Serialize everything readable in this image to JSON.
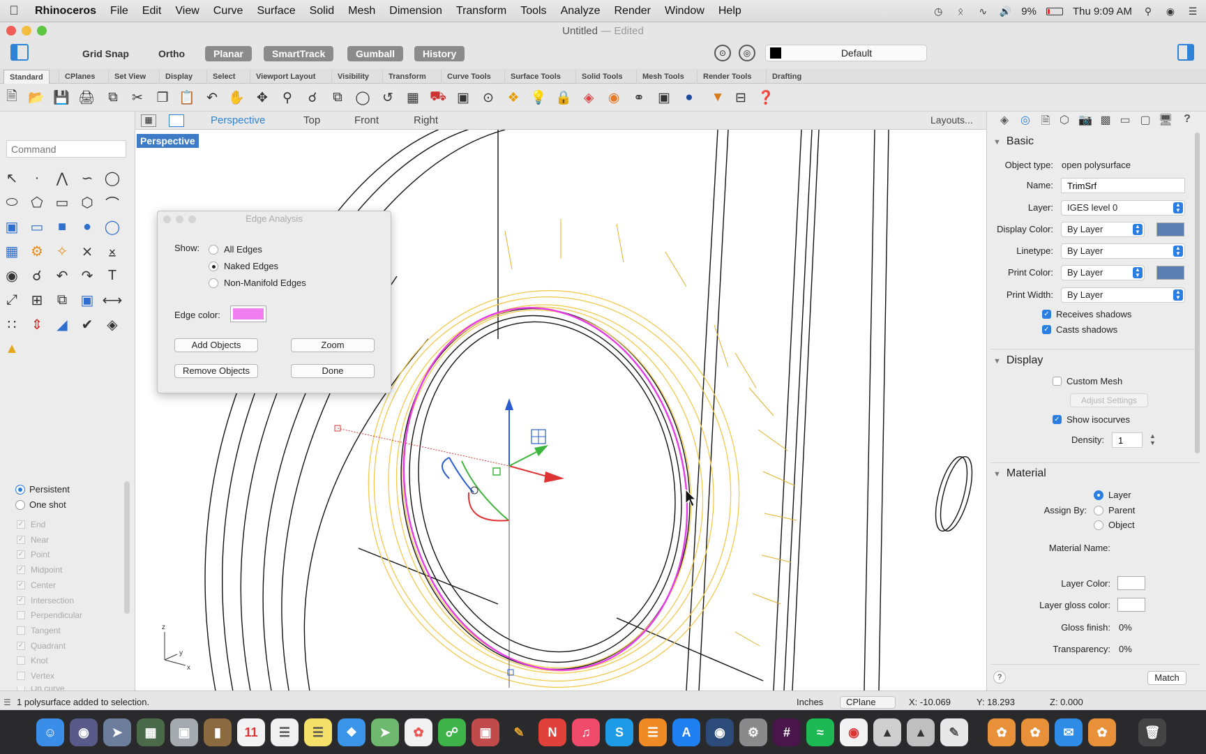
{
  "menubar": {
    "app_name": "Rhinoceros",
    "items": [
      "File",
      "Edit",
      "View",
      "Curve",
      "Surface",
      "Solid",
      "Mesh",
      "Dimension",
      "Transform",
      "Tools",
      "Analyze",
      "Render",
      "Window",
      "Help"
    ],
    "battery": "9%",
    "clock": "Thu 9:09 AM"
  },
  "window": {
    "title": "Untitled",
    "title_suffix": "— Edited"
  },
  "toggles": {
    "grid_snap": "Grid Snap",
    "ortho": "Ortho",
    "planar": "Planar",
    "smarttrack": "SmartTrack",
    "gumball": "Gumball",
    "history": "History",
    "layer": "Default"
  },
  "tabs": [
    "Standard",
    "CPlanes",
    "Set View",
    "Display",
    "Select",
    "Viewport Layout",
    "Visibility",
    "Transform",
    "Curve Tools",
    "Surface Tools",
    "Solid Tools",
    "Mesh Tools",
    "Render Tools",
    "Drafting"
  ],
  "command": {
    "placeholder": "Command"
  },
  "viewport_tabs": {
    "perspective": "Perspective",
    "top": "Top",
    "front": "Front",
    "right": "Right",
    "layouts": "Layouts..."
  },
  "viewport": {
    "label": "Perspective"
  },
  "osnap": {
    "persistent": "Persistent",
    "one_shot": "One shot",
    "items": [
      {
        "label": "End",
        "checked": true
      },
      {
        "label": "Near",
        "checked": true
      },
      {
        "label": "Point",
        "checked": true
      },
      {
        "label": "Midpoint",
        "checked": true
      },
      {
        "label": "Center",
        "checked": true
      },
      {
        "label": "Intersection",
        "checked": true
      },
      {
        "label": "Perpendicular",
        "checked": false
      },
      {
        "label": "Tangent",
        "checked": false
      },
      {
        "label": "Quadrant",
        "checked": true
      },
      {
        "label": "Knot",
        "checked": false
      },
      {
        "label": "Vertex",
        "checked": false
      },
      {
        "label": "On curve",
        "checked": false
      }
    ]
  },
  "dialog": {
    "title": "Edge Analysis",
    "show_label": "Show:",
    "all_edges": "All Edges",
    "naked_edges": "Naked Edges",
    "non_manifold": "Non-Manifold Edges",
    "edge_color_label": "Edge color:",
    "edge_color": "#f07ef0",
    "add_objects": "Add Objects",
    "zoom": "Zoom",
    "remove_objects": "Remove Objects",
    "done": "Done"
  },
  "properties": {
    "basic_header": "Basic",
    "object_type_label": "Object type:",
    "object_type": "open polysurface",
    "name_label": "Name:",
    "name": "TrimSrf",
    "layer_label": "Layer:",
    "layer": "IGES level 0",
    "display_color_label": "Display Color:",
    "display_color": "By Layer",
    "linetype_label": "Linetype:",
    "linetype": "By Layer",
    "print_color_label": "Print Color:",
    "print_color": "By Layer",
    "print_width_label": "Print Width:",
    "print_width": "By Layer",
    "receives_shadows": "Receives shadows",
    "casts_shadows": "Casts shadows",
    "display_header": "Display",
    "custom_mesh": "Custom Mesh",
    "adjust_settings": "Adjust Settings",
    "show_isocurves": "Show isocurves",
    "density_label": "Density:",
    "density": "1",
    "material_header": "Material",
    "assign_by_label": "Assign By:",
    "assign_layer": "Layer",
    "assign_parent": "Parent",
    "assign_object": "Object",
    "material_name_label": "Material Name:",
    "layer_color_label": "Layer Color:",
    "layer_gloss_label": "Layer gloss color:",
    "gloss_finish_label": "Gloss finish:",
    "gloss_finish": "0%",
    "transparency_label": "Transparency:",
    "transparency": "0%",
    "help": "?",
    "match": "Match",
    "swatch_color": "#5b7fb0"
  },
  "status": {
    "message": "1 polysurface added to selection.",
    "units": "Inches",
    "cplane": "CPlane",
    "x": "X: -10.069",
    "y": "Y: 18.293",
    "z": "Z: 0.000"
  }
}
